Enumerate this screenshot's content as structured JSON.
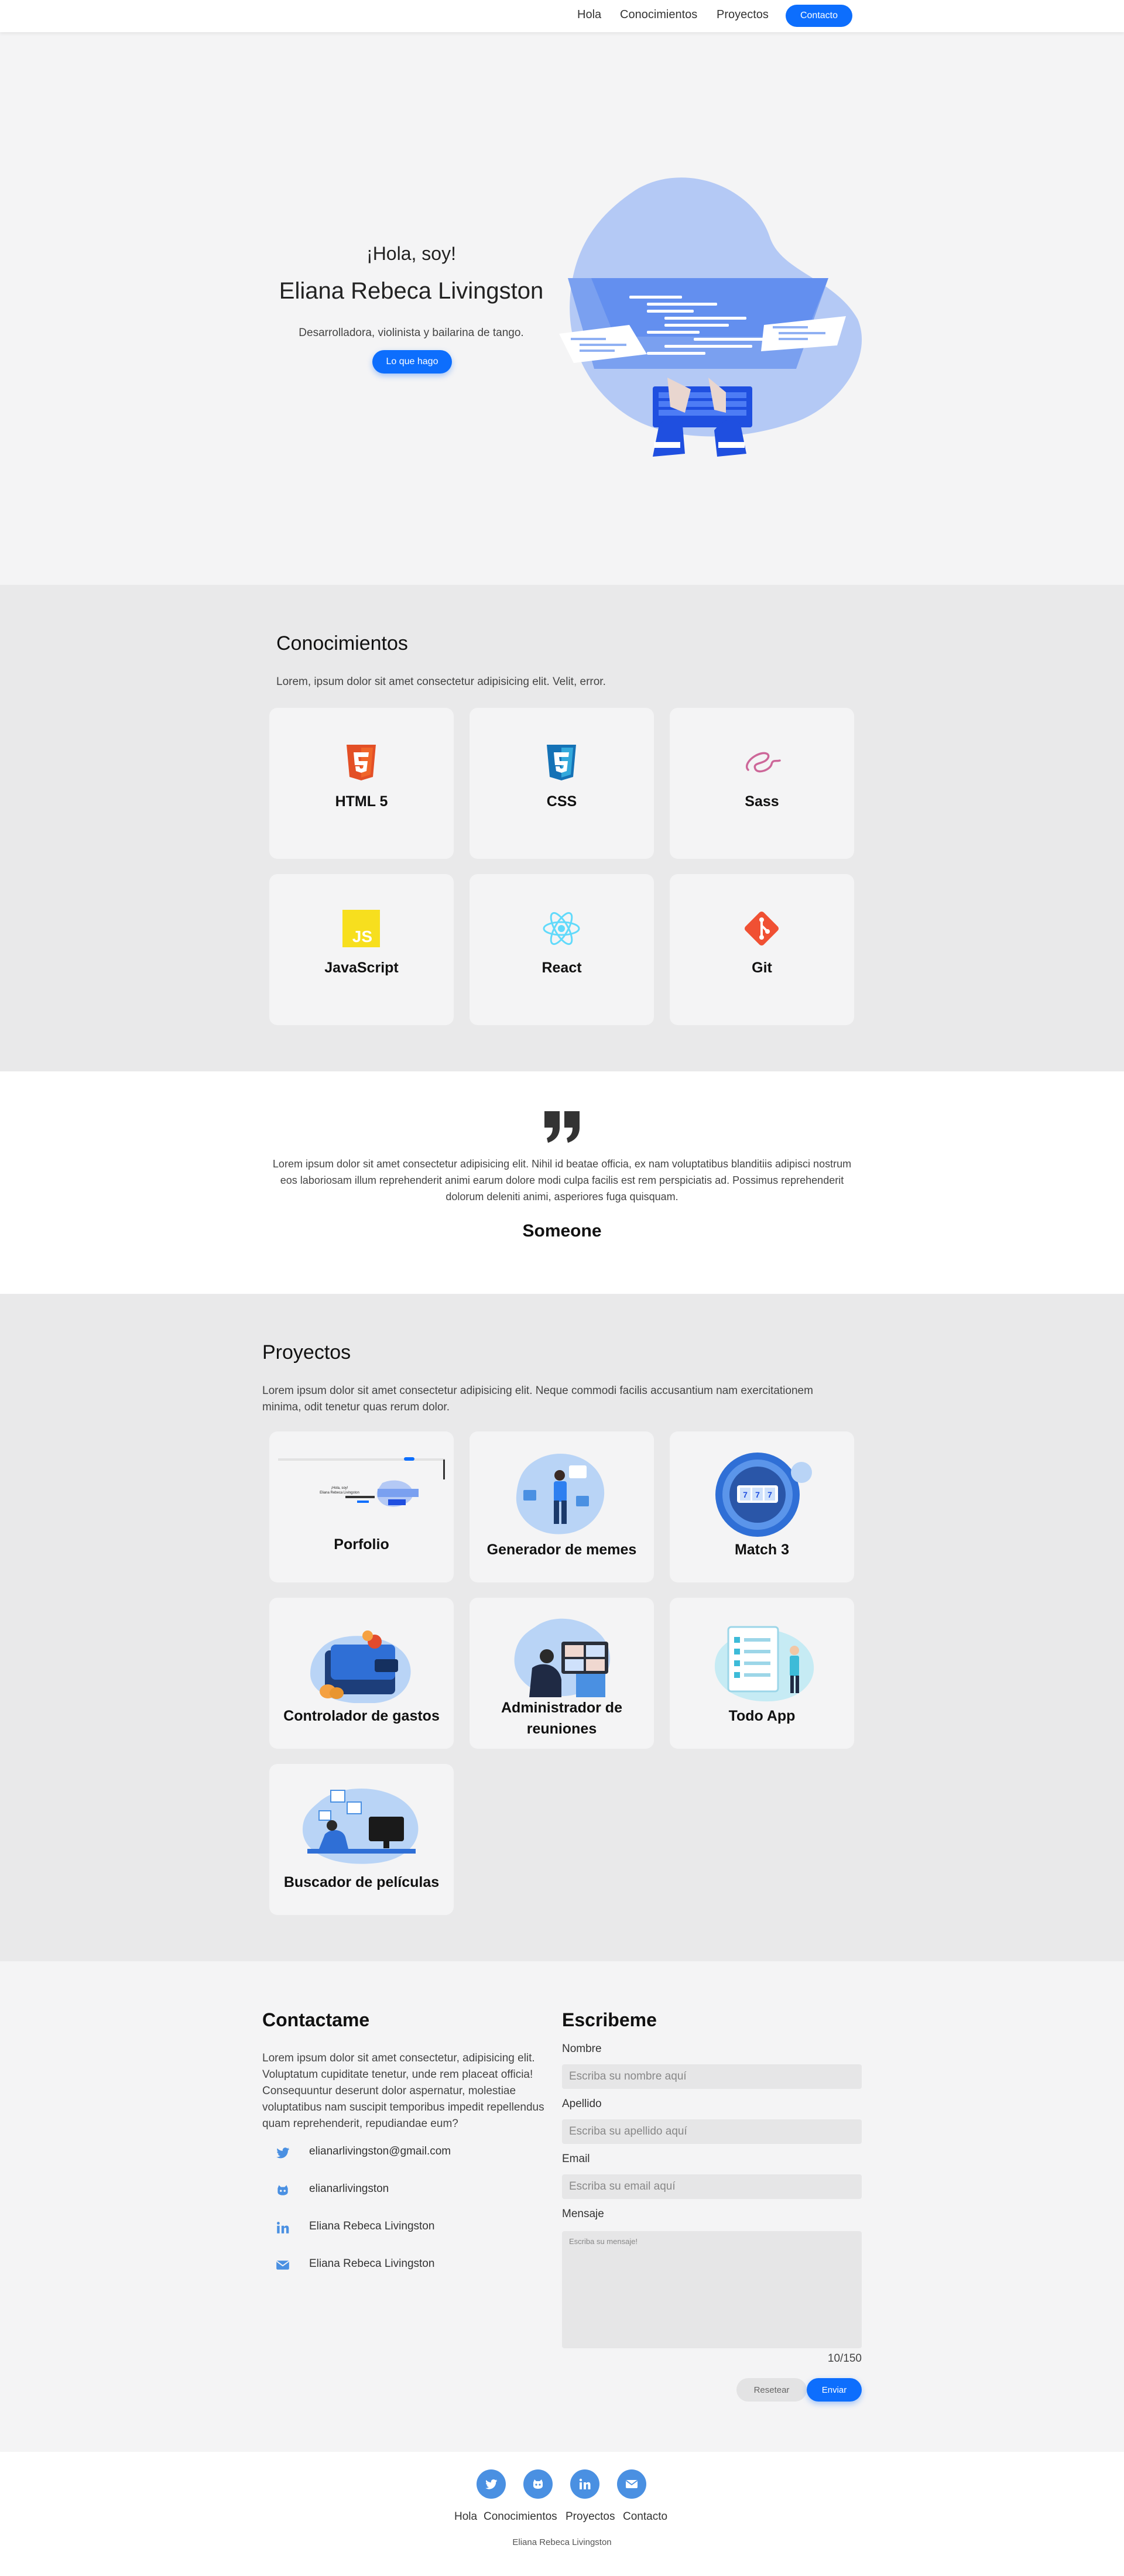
{
  "colors": {
    "accent": "#0d6efd",
    "social": "#4a90e2",
    "illustration": "#b4c9f5"
  },
  "nav": {
    "items": [
      "Hola",
      "Conocimientos",
      "Proyectos"
    ],
    "contact_button": "Contacto"
  },
  "hero": {
    "greeting": "¡Hola, soy!",
    "name": "Eliana Rebeca Livingston",
    "description": "Desarrolladora, violinista y bailarina de tango.",
    "button": "Lo que hago"
  },
  "skills": {
    "title": "Conocimientos",
    "description": "Lorem, ipsum dolor sit amet consectetur adipisicing elit. Velit, error.",
    "items": [
      {
        "label": "HTML 5",
        "icon": "html5-icon"
      },
      {
        "label": "CSS",
        "icon": "css3-icon"
      },
      {
        "label": "Sass",
        "icon": "sass-icon"
      },
      {
        "label": "JavaScript",
        "icon": "javascript-icon"
      },
      {
        "label": "React",
        "icon": "react-icon"
      },
      {
        "label": "Git",
        "icon": "git-icon"
      }
    ]
  },
  "quote": {
    "text": "Lorem ipsum dolor sit amet consectetur adipisicing elit. Nihil id beatae officia, ex nam voluptatibus blanditiis adipisci nostrum eos laboriosam illum reprehenderit animi earum dolore modi culpa facilis est rem perspiciatis ad. Possimus reprehenderit dolorum deleniti animi, asperiores fuga quisquam.",
    "author": "Someone"
  },
  "projects": {
    "title": "Proyectos",
    "description": "Lorem ipsum dolor sit amet consectetur adipisicing elit. Neque commodi facilis accusantium nam exercitationem minima, odit tenetur quas rerum dolor.",
    "items": [
      {
        "label": "Porfolio"
      },
      {
        "label": "Generador de memes"
      },
      {
        "label": "Match 3"
      },
      {
        "label": "Controlador de gastos"
      },
      {
        "label": "Administrador de reuniones"
      },
      {
        "label": "Todo App"
      },
      {
        "label": "Buscador de películas"
      }
    ],
    "thumb_texts": {
      "portfolio_greet": "¡Hola, soy!",
      "portfolio_name": "Eliana Rebeca Livingston"
    }
  },
  "contact": {
    "title": "Contactame",
    "description": "Lorem ipsum dolor sit amet consectetur, adipisicing elit. Voluptatum cupiditate tenetur, unde rem placeat officia! Consequuntur deserunt dolor aspernatur, molestiae voluptatibus nam suscipit temporibus impedit repellendus quam reprehenderit, repudiandae eum?",
    "rows": [
      {
        "icon": "twitter-icon",
        "text": "elianarlivingston@gmail.com"
      },
      {
        "icon": "github-icon",
        "text": "elianarlivingston"
      },
      {
        "icon": "linkedin-icon",
        "text": "Eliana Rebeca Livingston"
      },
      {
        "icon": "mail-icon",
        "text": "Eliana Rebeca Livingston"
      }
    ]
  },
  "form": {
    "title": "Escribeme",
    "name_label": "Nombre",
    "name_placeholder": "Escriba su nombre aquí",
    "surname_label": "Apellido",
    "surname_placeholder": "Escriba su apellido aquí",
    "email_label": "Email",
    "email_placeholder": "Escriba su email aquí",
    "message_label": "Mensaje",
    "message_placeholder": "Escriba su mensaje!",
    "counter": "10/150",
    "reset": "Resetear",
    "send": "Enviar"
  },
  "footer": {
    "social": [
      "twitter-icon",
      "github-icon",
      "linkedin-icon",
      "mail-icon"
    ],
    "links": [
      "Hola",
      "Conocimientos",
      "Proyectos",
      "Contacto"
    ],
    "copyright": "Eliana Rebeca Livingston"
  }
}
